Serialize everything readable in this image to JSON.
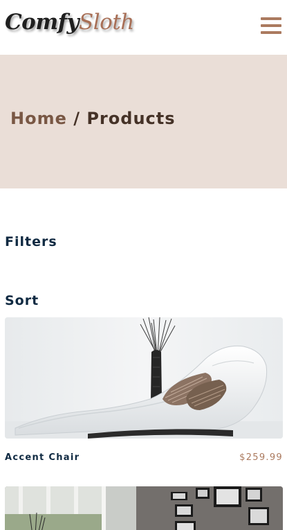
{
  "brand": {
    "name_part1": "Comfy",
    "name_part2": "Sloth"
  },
  "nav": {
    "menu_icon": "hamburger-menu-icon",
    "menu_color": "#ab7a5f"
  },
  "hero": {
    "background": "#eaded7",
    "breadcrumb": {
      "home": "Home",
      "separator": " / ",
      "current": "Products"
    }
  },
  "sections": {
    "filters": "Filters",
    "sort": "Sort"
  },
  "products": [
    {
      "name": "Accent Chair",
      "price": "$259.99",
      "image": "white-chaise-lounge-photo"
    },
    {
      "image": "living-room-wall-frames-photo"
    }
  ],
  "colors": {
    "accent": "#ab7a5f",
    "heading": "#102a42",
    "hero_text": "#453227"
  }
}
